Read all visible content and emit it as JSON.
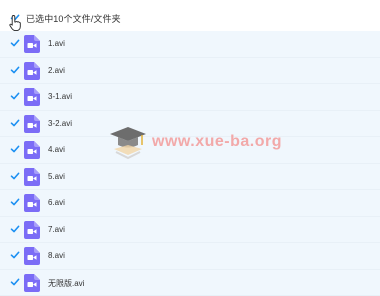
{
  "header": {
    "selection_text": "已选中10个文件/文件夹"
  },
  "files": [
    {
      "name": "1.avi"
    },
    {
      "name": "2.avi"
    },
    {
      "name": "3-1.avi"
    },
    {
      "name": "3-2.avi"
    },
    {
      "name": "4.avi"
    },
    {
      "name": "5.avi"
    },
    {
      "name": "6.avi"
    },
    {
      "name": "7.avi"
    },
    {
      "name": "8.avi"
    },
    {
      "name": "无限版.avi"
    }
  ],
  "watermark": {
    "text": "www.xue-ba.org"
  },
  "colors": {
    "checkbox": "#1a8ff2",
    "video_icon": "#7b6cf6",
    "row_bg": "#f0f7fd",
    "breadcrumb": "#8ec8ee"
  },
  "icons": {
    "checkbox": "checkbox-checked-icon",
    "file": "video-file-icon",
    "cursor": "mouse-cursor-icon",
    "watermark_logo": "graduation-cap-icon"
  }
}
